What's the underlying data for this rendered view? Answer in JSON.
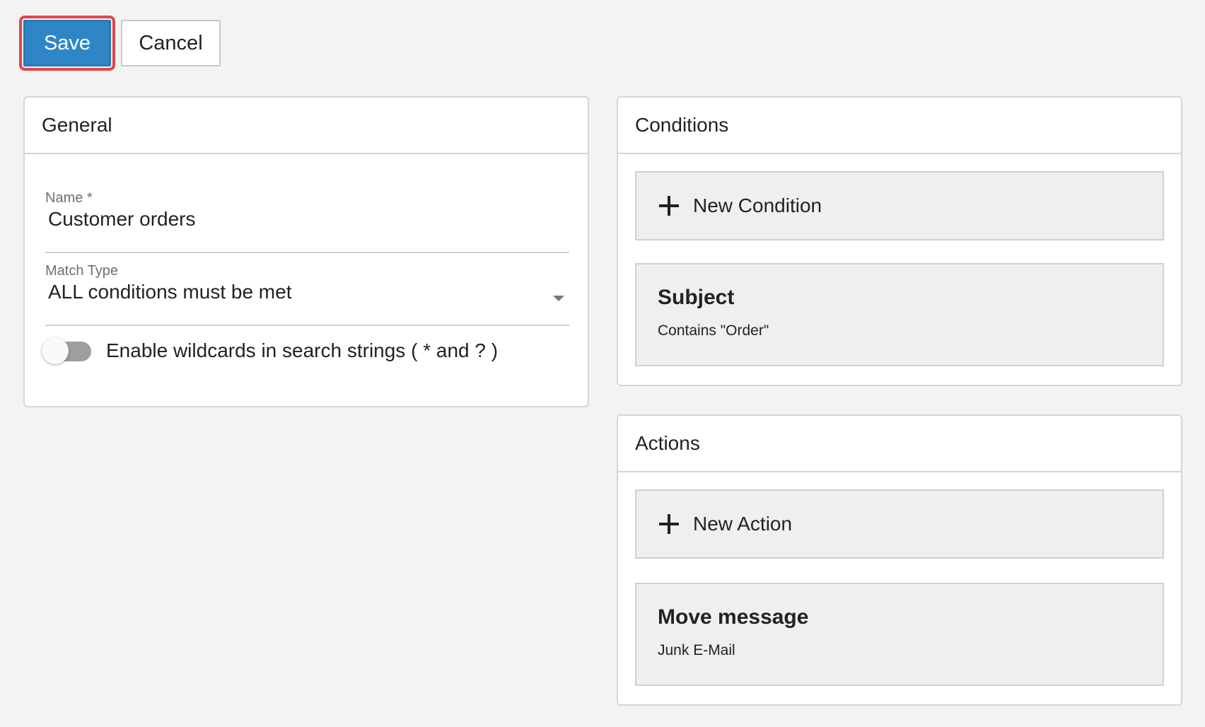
{
  "toolbar": {
    "save_label": "Save",
    "cancel_label": "Cancel"
  },
  "general": {
    "title": "General",
    "name_label": "Name *",
    "name_value": "Customer orders",
    "match_type_label": "Match Type",
    "match_type_value": "ALL conditions must be met",
    "wildcards_label": "Enable wildcards in search strings ( * and ? )",
    "wildcards_enabled": false
  },
  "conditions": {
    "title": "Conditions",
    "new_label": "New Condition",
    "items": [
      {
        "title": "Subject",
        "detail": "Contains \"Order\""
      }
    ]
  },
  "actions": {
    "title": "Actions",
    "new_label": "New Action",
    "items": [
      {
        "title": "Move message",
        "detail": "Junk E-Mail"
      }
    ]
  },
  "colors": {
    "primary": "#2f86c6",
    "focus_ring": "#e0454f",
    "background": "#f3f3f3"
  }
}
